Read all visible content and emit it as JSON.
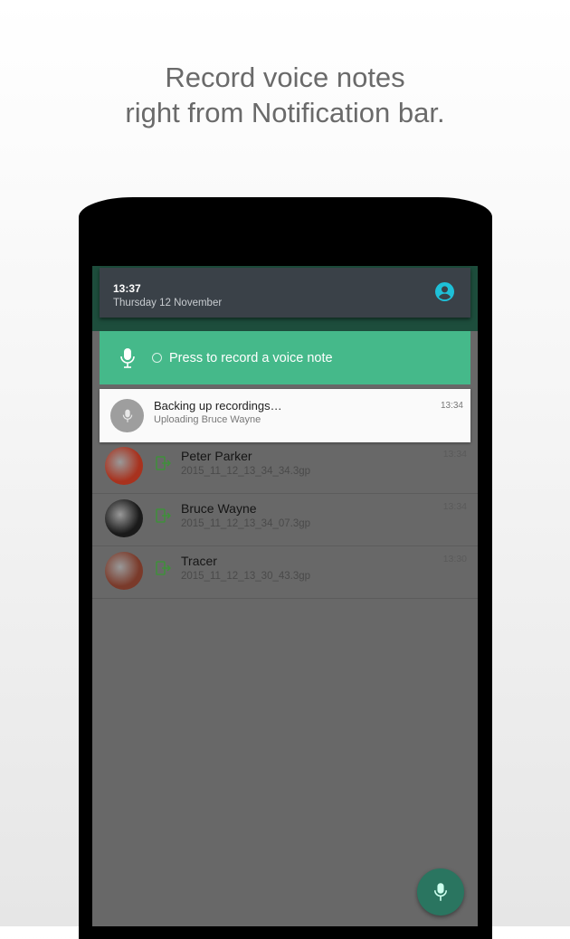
{
  "headline": {
    "line1": "Record voice notes",
    "line2": "right from Notification bar."
  },
  "quick_settings": {
    "time": "13:37",
    "date": "Thursday 12 November",
    "icon": "account-circle-icon"
  },
  "record_notification": {
    "label": "Press to record a voice note",
    "icon": "microphone-icon"
  },
  "backup_notification": {
    "title": "Backing up recordings…",
    "subtitle": "Uploading Bruce Wayne",
    "time": "13:34"
  },
  "recordings": [
    {
      "name": "Peter Parker",
      "file": "2015_11_12_13_34_34.3gp",
      "time": "13:34",
      "avatar_color": "#a8321e"
    },
    {
      "name": "Bruce Wayne",
      "file": "2015_11_12_13_34_07.3gp",
      "time": "13:34",
      "avatar_color": "#1a1a1a"
    },
    {
      "name": "Tracer",
      "file": "2015_11_12_13_30_43.3gp",
      "time": "13:30",
      "avatar_color": "#7a3a2a"
    }
  ],
  "colors": {
    "accent": "#45b98a",
    "share_icon": "#3f8f3a"
  }
}
